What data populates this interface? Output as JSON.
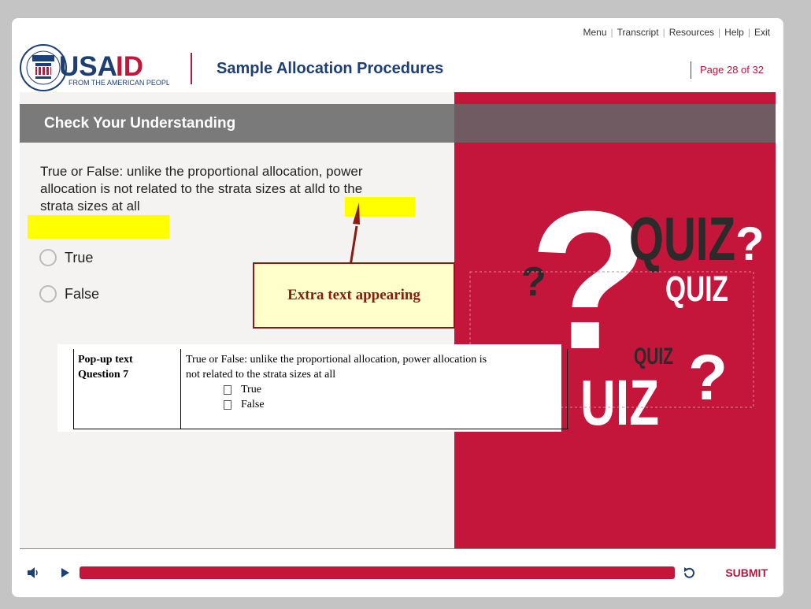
{
  "topnav": {
    "menu": "Menu",
    "transcript": "Transcript",
    "resources": "Resources",
    "help": "Help",
    "exit": "Exit"
  },
  "brand": {
    "name": "USAID",
    "tagline": "FROM THE AMERICAN PEOPLE",
    "seal_text": "USAID"
  },
  "course": {
    "title": "Sample Allocation Procedures"
  },
  "page": {
    "indicator": "Page 28 of  32"
  },
  "header": {
    "title": "Check Your Understanding"
  },
  "question": {
    "line1": "True or False: unlike the proportional allocation, power",
    "line2": "allocation is not related to the strata sizes at alld to the",
    "line3": "strata sizes at all"
  },
  "options": [
    {
      "label": "True"
    },
    {
      "label": "False"
    }
  ],
  "callout": {
    "text": "Extra text appearing"
  },
  "popup": {
    "label_line1": "Pop-up text",
    "label_line2": "Question 7",
    "question_line1": "True or False: unlike the proportional allocation, power allocation is",
    "question_line2": "not related to the strata sizes at all",
    "items": [
      "True",
      "False"
    ]
  },
  "quiz_art": {
    "words": [
      "QUIZ",
      "?",
      "QUIZ",
      "QUIZ",
      "?",
      "?",
      "UIZ"
    ]
  },
  "controls": {
    "submit": "SUBMIT",
    "progress_fraction": 1.0
  },
  "colors": {
    "brand_red": "#c4163b",
    "navy": "#1c3f75",
    "highlight": "#ffff00"
  }
}
